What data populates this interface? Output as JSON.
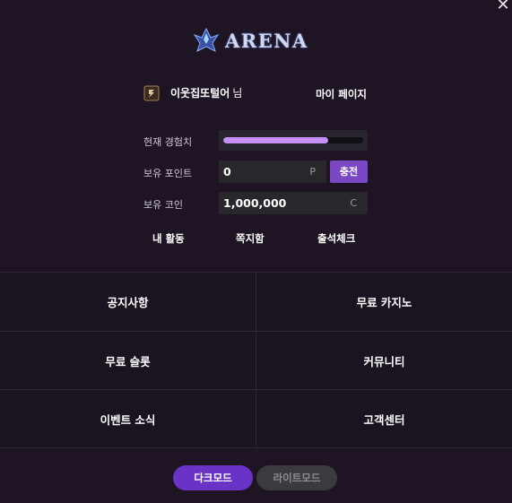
{
  "close_icon": "close-icon",
  "logo": {
    "text": "ARENA",
    "icon": "arena-emblem-icon"
  },
  "user": {
    "badge_icon": "level-badge-icon",
    "name": "이웃집또털어",
    "suffix": "님",
    "mypage_label": "마이 페이지"
  },
  "stats": {
    "xp_label": "현재 경험치",
    "xp_progress": 0.75,
    "points_label": "보유 포인트",
    "points_value": "0",
    "points_unit": "P",
    "charge_label": "충전",
    "coins_label": "보유 코인",
    "coins_value": "1,000,000",
    "coins_unit": "C"
  },
  "quick_links": {
    "activity": "내 활동",
    "messages": "쪽지함",
    "attendance": "출석체크"
  },
  "menu": {
    "notice": "공지사항",
    "free_casino": "무료 카지노",
    "free_slots": "무료 슬롯",
    "community": "커뮤니티",
    "events": "이벤트 소식",
    "support": "고객센터"
  },
  "modes": {
    "dark": "다크모드",
    "light": "라이트모드"
  },
  "colors": {
    "background": "#1e1424",
    "accent": "#7b48c4",
    "xp_fill": "#c68ef8",
    "dark_mode_button": "#6a33c7",
    "light_mode_button": "#3b3a3f"
  }
}
